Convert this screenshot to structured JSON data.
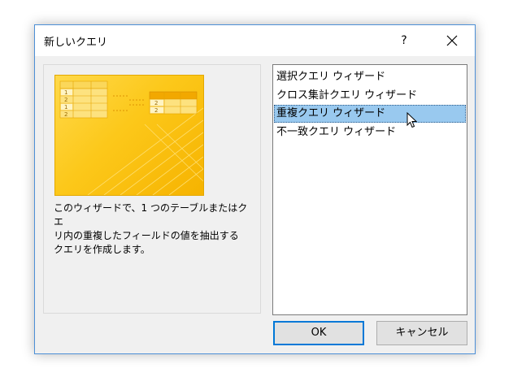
{
  "window": {
    "title": "新しいクエリ",
    "help_label": "?"
  },
  "description": "このウィザードで、1 つのテーブルまたはクエ\nリ内の重複したフィールドの値を抽出する\nクエリを作成します。",
  "preview": {
    "left_table_rows": [
      "1",
      "2",
      "1",
      "2"
    ],
    "right_table_rows": [
      "2",
      "2"
    ]
  },
  "wizards": [
    {
      "label": "選択クエリ ウィザード",
      "selected": false
    },
    {
      "label": "クロス集計クエリ ウィザード",
      "selected": false
    },
    {
      "label": "重複クエリ ウィザード",
      "selected": true
    },
    {
      "label": "不一致クエリ ウィザード",
      "selected": false
    }
  ],
  "buttons": {
    "ok": "OK",
    "cancel": "キャンセル"
  },
  "colors": {
    "accent": "#0078d7",
    "selection": "#99c9ef",
    "window_border": "#4c8fd6",
    "preview_bg": "#fcc81a"
  }
}
